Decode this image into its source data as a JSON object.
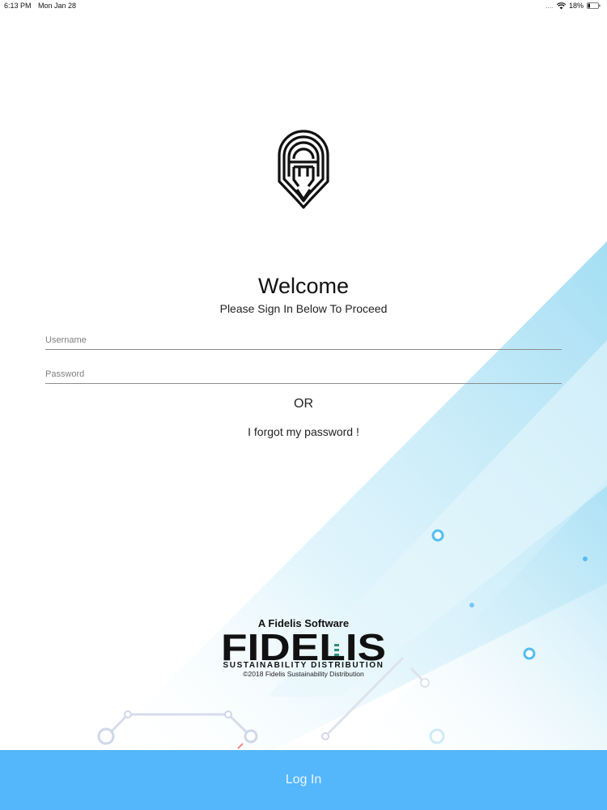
{
  "status_bar": {
    "time": "6:13 PM",
    "date": "Mon Jan 28",
    "signal": "....",
    "battery": "18%",
    "icons": [
      "wifi-icon",
      "battery-icon"
    ]
  },
  "logo": {
    "icon": "helmet-logo-icon"
  },
  "header": {
    "title": "Welcome",
    "subtitle": "Please Sign In Below To Proceed"
  },
  "form": {
    "username_placeholder": "Username",
    "username_value": "",
    "password_placeholder": "Password",
    "password_value": ""
  },
  "or_label": "OR",
  "forgot_password_label": "I forgot my password !",
  "branding": {
    "tagline": "A Fidelis Software",
    "wordmark": "FIDELIS",
    "subline": "SUSTAINABILITY DISTRIBUTION",
    "copyright": "©2018 Fidelis Sustainability Distribution"
  },
  "login_button_label": "Log In",
  "colors": {
    "primary": "#54b6fb",
    "accent_light": "#bfe6f7",
    "text": "#111111"
  }
}
